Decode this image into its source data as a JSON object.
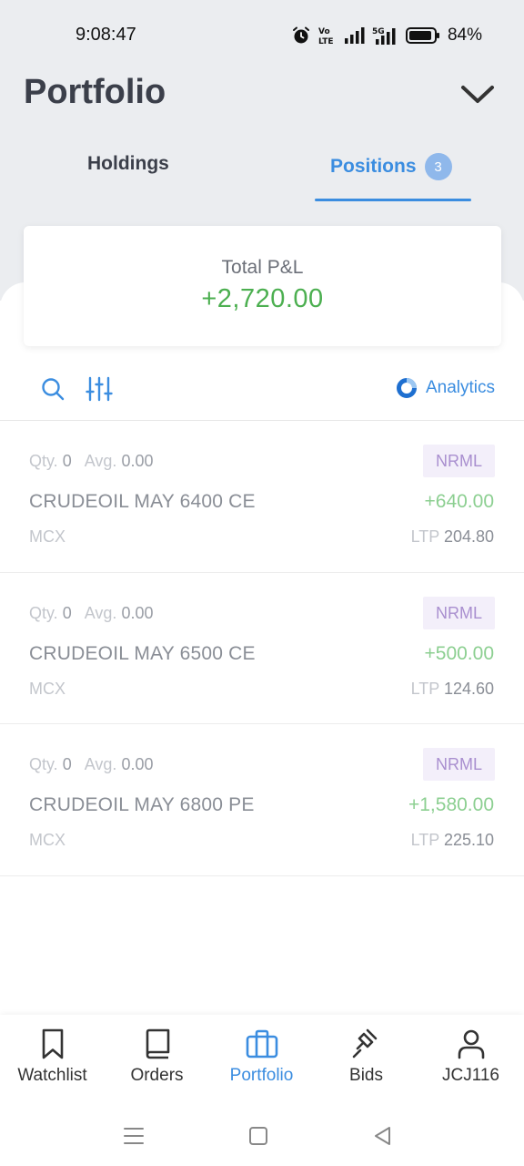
{
  "status_bar": {
    "time": "9:08:47",
    "battery": "84%",
    "network_lte_label": "Vo LTE",
    "network_5g_label": "5G"
  },
  "header": {
    "title": "Portfolio"
  },
  "tabs": [
    {
      "label": "Holdings",
      "active": false
    },
    {
      "label": "Positions",
      "active": true,
      "badge": "3"
    }
  ],
  "summary": {
    "label": "Total P&L",
    "value": "+2,720.00"
  },
  "toolbar": {
    "analytics_label": "Analytics"
  },
  "positions": [
    {
      "qty_label": "Qty.",
      "qty": "0",
      "avg_label": "Avg.",
      "avg": "0.00",
      "product": "NRML",
      "symbol": "CRUDEOIL MAY 6400 CE",
      "pnl": "+640.00",
      "exchange": "MCX",
      "ltp_label": "LTP",
      "ltp": "204.80"
    },
    {
      "qty_label": "Qty.",
      "qty": "0",
      "avg_label": "Avg.",
      "avg": "0.00",
      "product": "NRML",
      "symbol": "CRUDEOIL MAY 6500 CE",
      "pnl": "+500.00",
      "exchange": "MCX",
      "ltp_label": "LTP",
      "ltp": "124.60"
    },
    {
      "qty_label": "Qty.",
      "qty": "0",
      "avg_label": "Avg.",
      "avg": "0.00",
      "product": "NRML",
      "symbol": "CRUDEOIL MAY 6800 PE",
      "pnl": "+1,580.00",
      "exchange": "MCX",
      "ltp_label": "LTP",
      "ltp": "225.10"
    }
  ],
  "bottom_nav": [
    {
      "label": "Watchlist",
      "icon": "bookmark-icon",
      "active": false
    },
    {
      "label": "Orders",
      "icon": "book-icon",
      "active": false
    },
    {
      "label": "Portfolio",
      "icon": "briefcase-icon",
      "active": true
    },
    {
      "label": "Bids",
      "icon": "gavel-icon",
      "active": false
    },
    {
      "label": "JCJ116",
      "icon": "user-icon",
      "active": false
    }
  ],
  "colors": {
    "accent": "#3b8de0",
    "profit": "#4caf50",
    "header_bg": "#ebedf0",
    "product_tag_bg": "#f3effa",
    "product_tag_text": "#a98fcf"
  }
}
